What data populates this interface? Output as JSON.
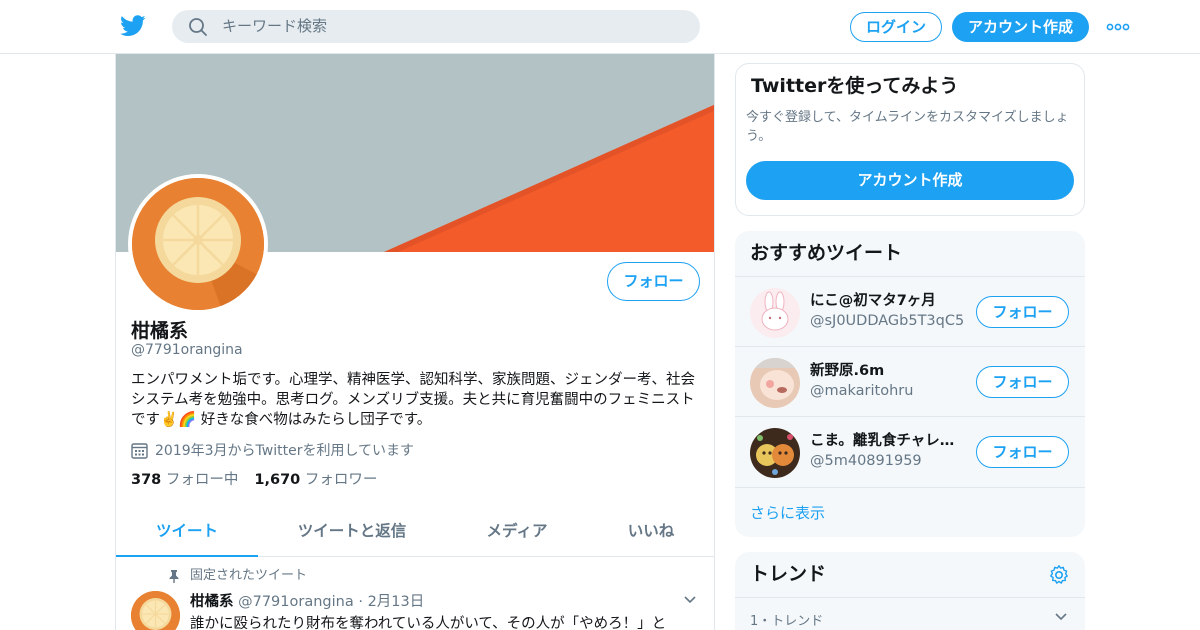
{
  "header": {
    "search_placeholder": "キーワード検索",
    "login_label": "ログイン",
    "signup_label": "アカウント作成"
  },
  "profile": {
    "name": "柑橘系",
    "handle": "@7791orangina",
    "follow_label": "フォロー",
    "bio": "エンパワメント垢です。心理学、精神医学、認知科学、家族問題、ジェンダー考、社会システム考を勉強中。思考ログ。メンズリブ支援。夫と共に育児奮闘中のフェミニストです✌️🌈 好きな食べ物はみたらし団子です。",
    "joined": "2019年3月からTwitterを利用しています",
    "following_count": "378",
    "following_label": "フォロー中",
    "followers_count": "1,670",
    "followers_label": "フォロワー"
  },
  "tabs": [
    "ツイート",
    "ツイートと返信",
    "メディア",
    "いいね"
  ],
  "pinned_tweet": {
    "label": "固定されたツイート",
    "name": "柑橘系",
    "handle": "@7791orangina",
    "separator": "·",
    "date": "2月13日",
    "text": "誰かに殴られたり財布を奪われている人がいて、その人が「やめろ！」と"
  },
  "sidebar": {
    "signup_card": {
      "title": "Twitterを使ってみよう",
      "subtitle": "今すぐ登録して、タイムラインをカスタマイズしましょう。",
      "button_label": "アカウント作成"
    },
    "recommended": {
      "title": "おすすめツイート",
      "follow_label": "フォロー",
      "items": [
        {
          "name": "にこ@初マタ7ヶ月",
          "handle": "@sJ0UDDAGb5T3qC5"
        },
        {
          "name": "新野原.6m",
          "handle": "@makaritohru"
        },
        {
          "name": "こま。離乳食チャレンジ中",
          "handle": "@5m40891959"
        }
      ],
      "show_more": "さらに表示"
    },
    "trends": {
      "title": "トレンド",
      "first_meta": "1・トレンド"
    }
  },
  "colors": {
    "accent": "#1da1f2",
    "banner_gray": "#b3c2c5",
    "banner_orange": "#f35b2b",
    "avatar_orange": "#e88131"
  }
}
